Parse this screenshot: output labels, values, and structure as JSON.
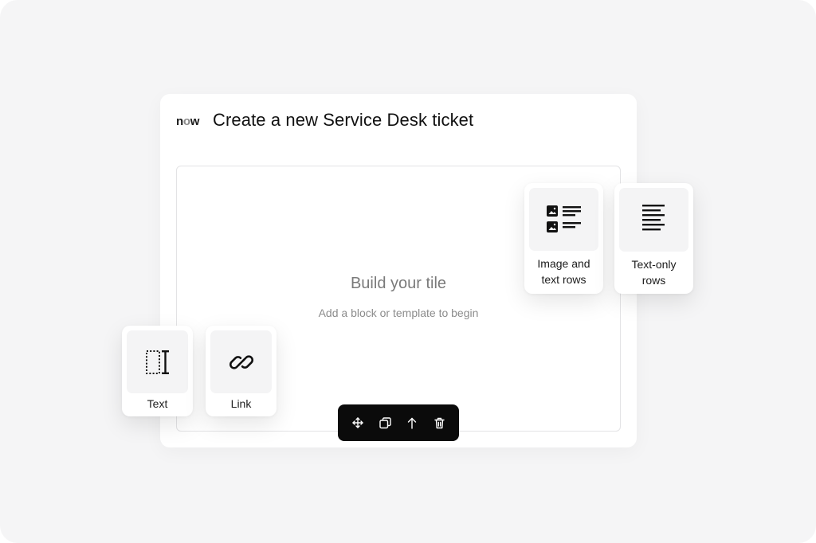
{
  "header": {
    "brand_logo": "now",
    "title": "Create a new Service Desk ticket"
  },
  "canvas": {
    "empty_title": "Build your tile",
    "empty_subtitle": "Add a block or template to begin"
  },
  "templates": [
    {
      "label_line1": "Image and",
      "label_line2": "text rows",
      "icon": "image-text-rows-icon"
    },
    {
      "label_line1": "Text-only",
      "label_line2": "rows",
      "icon": "text-rows-icon"
    }
  ],
  "blocks": [
    {
      "label": "Text",
      "icon": "text-cursor-icon"
    },
    {
      "label": "Link",
      "icon": "link-icon"
    }
  ],
  "toolbar": {
    "actions": [
      "move-icon",
      "duplicate-icon",
      "move-up-icon",
      "delete-icon"
    ]
  }
}
